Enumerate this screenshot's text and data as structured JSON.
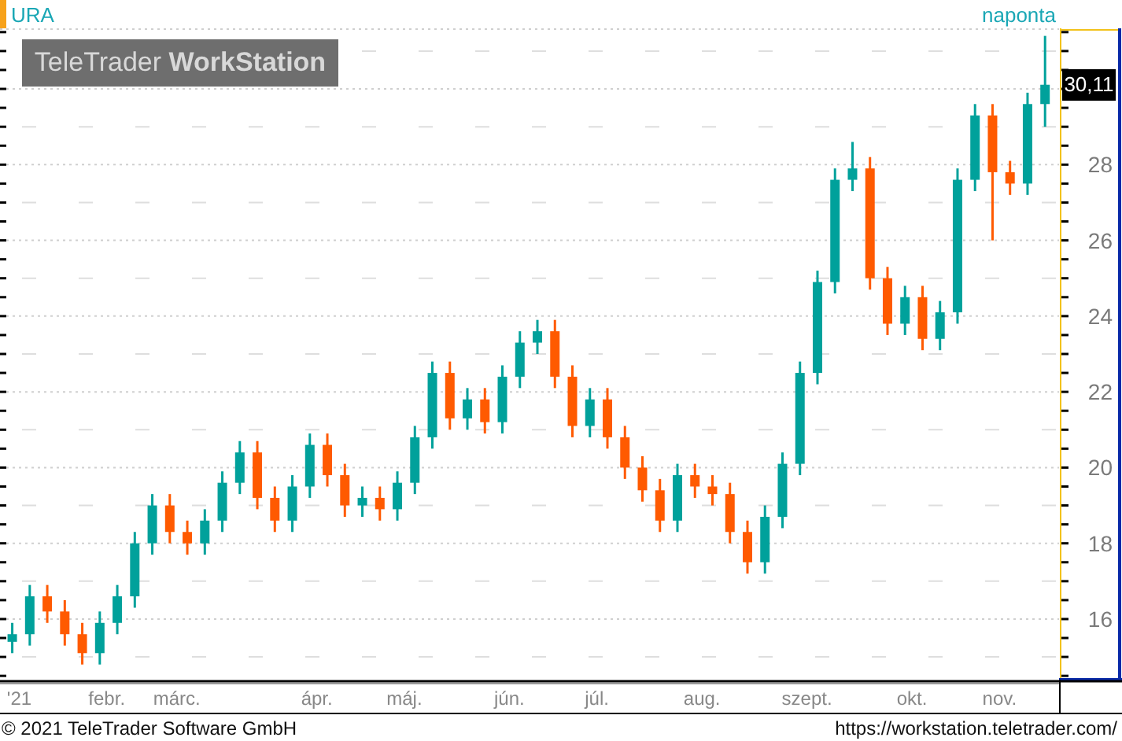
{
  "header": {
    "symbol": "URA",
    "interval": "naponta"
  },
  "logo": {
    "text": "TeleTrader **WorkStation**"
  },
  "chart": {
    "last_price": "30,11",
    "chart_data": {
      "type": "candlestick",
      "grid": true,
      "ylim": [
        14.4,
        31.6
      ],
      "yticks": [
        16,
        18,
        20,
        22,
        24,
        26,
        28
      ],
      "categories": [
        "'21",
        null,
        null,
        null,
        null,
        "febr.",
        null,
        null,
        null,
        "márc.",
        null,
        null,
        null,
        null,
        null,
        null,
        null,
        "ápr.",
        null,
        null,
        null,
        null,
        "máj.",
        null,
        null,
        null,
        null,
        null,
        "jún.",
        null,
        null,
        null,
        null,
        "júl.",
        null,
        null,
        null,
        null,
        null,
        "aug.",
        null,
        null,
        null,
        null,
        null,
        "szept.",
        null,
        null,
        null,
        null,
        null,
        "okt.",
        null,
        null,
        null,
        null,
        "nov.",
        null,
        null,
        null
      ],
      "ohlc": [
        [
          15.4,
          15.9,
          15.1,
          15.6
        ],
        [
          15.6,
          16.9,
          15.3,
          16.6
        ],
        [
          16.6,
          16.9,
          15.9,
          16.2
        ],
        [
          16.2,
          16.5,
          15.3,
          15.6
        ],
        [
          15.6,
          15.9,
          14.8,
          15.1
        ],
        [
          15.1,
          16.2,
          14.8,
          15.9
        ],
        [
          15.9,
          16.9,
          15.6,
          16.6
        ],
        [
          16.6,
          18.3,
          16.3,
          18.0
        ],
        [
          18.0,
          19.3,
          17.7,
          19.0
        ],
        [
          19.0,
          19.3,
          18.0,
          18.3
        ],
        [
          18.3,
          18.6,
          17.7,
          18.0
        ],
        [
          18.0,
          18.9,
          17.7,
          18.6
        ],
        [
          18.6,
          19.9,
          18.3,
          19.6
        ],
        [
          19.6,
          20.7,
          19.3,
          20.4
        ],
        [
          20.4,
          20.7,
          18.9,
          19.2
        ],
        [
          19.2,
          19.5,
          18.3,
          18.6
        ],
        [
          18.6,
          19.8,
          18.3,
          19.5
        ],
        [
          19.5,
          20.9,
          19.2,
          20.6
        ],
        [
          20.6,
          20.9,
          19.5,
          19.8
        ],
        [
          19.8,
          20.1,
          18.7,
          19.0
        ],
        [
          19.0,
          19.5,
          18.7,
          19.2
        ],
        [
          19.2,
          19.5,
          18.6,
          18.9
        ],
        [
          18.9,
          19.9,
          18.6,
          19.6
        ],
        [
          19.6,
          21.1,
          19.3,
          20.8
        ],
        [
          20.8,
          22.8,
          20.5,
          22.5
        ],
        [
          22.5,
          22.8,
          21.0,
          21.3
        ],
        [
          21.3,
          22.1,
          21.0,
          21.8
        ],
        [
          21.8,
          22.1,
          20.9,
          21.2
        ],
        [
          21.2,
          22.7,
          20.9,
          22.4
        ],
        [
          22.4,
          23.6,
          22.1,
          23.3
        ],
        [
          23.3,
          23.9,
          23.0,
          23.6
        ],
        [
          23.6,
          23.9,
          22.1,
          22.4
        ],
        [
          22.4,
          22.7,
          20.8,
          21.1
        ],
        [
          21.1,
          22.1,
          20.8,
          21.8
        ],
        [
          21.8,
          22.1,
          20.5,
          20.8
        ],
        [
          20.8,
          21.1,
          19.7,
          20.0
        ],
        [
          20.0,
          20.3,
          19.1,
          19.4
        ],
        [
          19.4,
          19.7,
          18.3,
          18.6
        ],
        [
          18.6,
          20.1,
          18.3,
          19.8
        ],
        [
          19.8,
          20.1,
          19.2,
          19.5
        ],
        [
          19.5,
          19.8,
          19.0,
          19.3
        ],
        [
          19.3,
          19.6,
          18.0,
          18.3
        ],
        [
          18.3,
          18.6,
          17.2,
          17.5
        ],
        [
          17.5,
          19.0,
          17.2,
          18.7
        ],
        [
          18.7,
          20.4,
          18.4,
          20.1
        ],
        [
          20.1,
          22.8,
          19.8,
          22.5
        ],
        [
          22.5,
          25.2,
          22.2,
          24.9
        ],
        [
          24.9,
          27.9,
          24.6,
          27.6
        ],
        [
          27.6,
          28.6,
          27.3,
          27.9
        ],
        [
          27.9,
          28.2,
          24.7,
          25.0
        ],
        [
          25.0,
          25.3,
          23.5,
          23.8
        ],
        [
          23.8,
          24.8,
          23.5,
          24.5
        ],
        [
          24.5,
          24.8,
          23.1,
          23.4
        ],
        [
          23.4,
          24.4,
          23.1,
          24.1
        ],
        [
          24.1,
          27.9,
          23.8,
          27.6
        ],
        [
          27.6,
          29.6,
          27.3,
          29.3
        ],
        [
          29.3,
          29.6,
          26.0,
          27.8
        ],
        [
          27.8,
          28.1,
          27.2,
          27.5
        ],
        [
          27.5,
          29.9,
          27.2,
          29.6
        ],
        [
          29.6,
          31.4,
          29.0,
          30.11
        ]
      ]
    }
  },
  "footer": {
    "copyright": "© 2021 TeleTrader Software GmbH",
    "url": "https://workstation.teletrader.com/"
  }
}
